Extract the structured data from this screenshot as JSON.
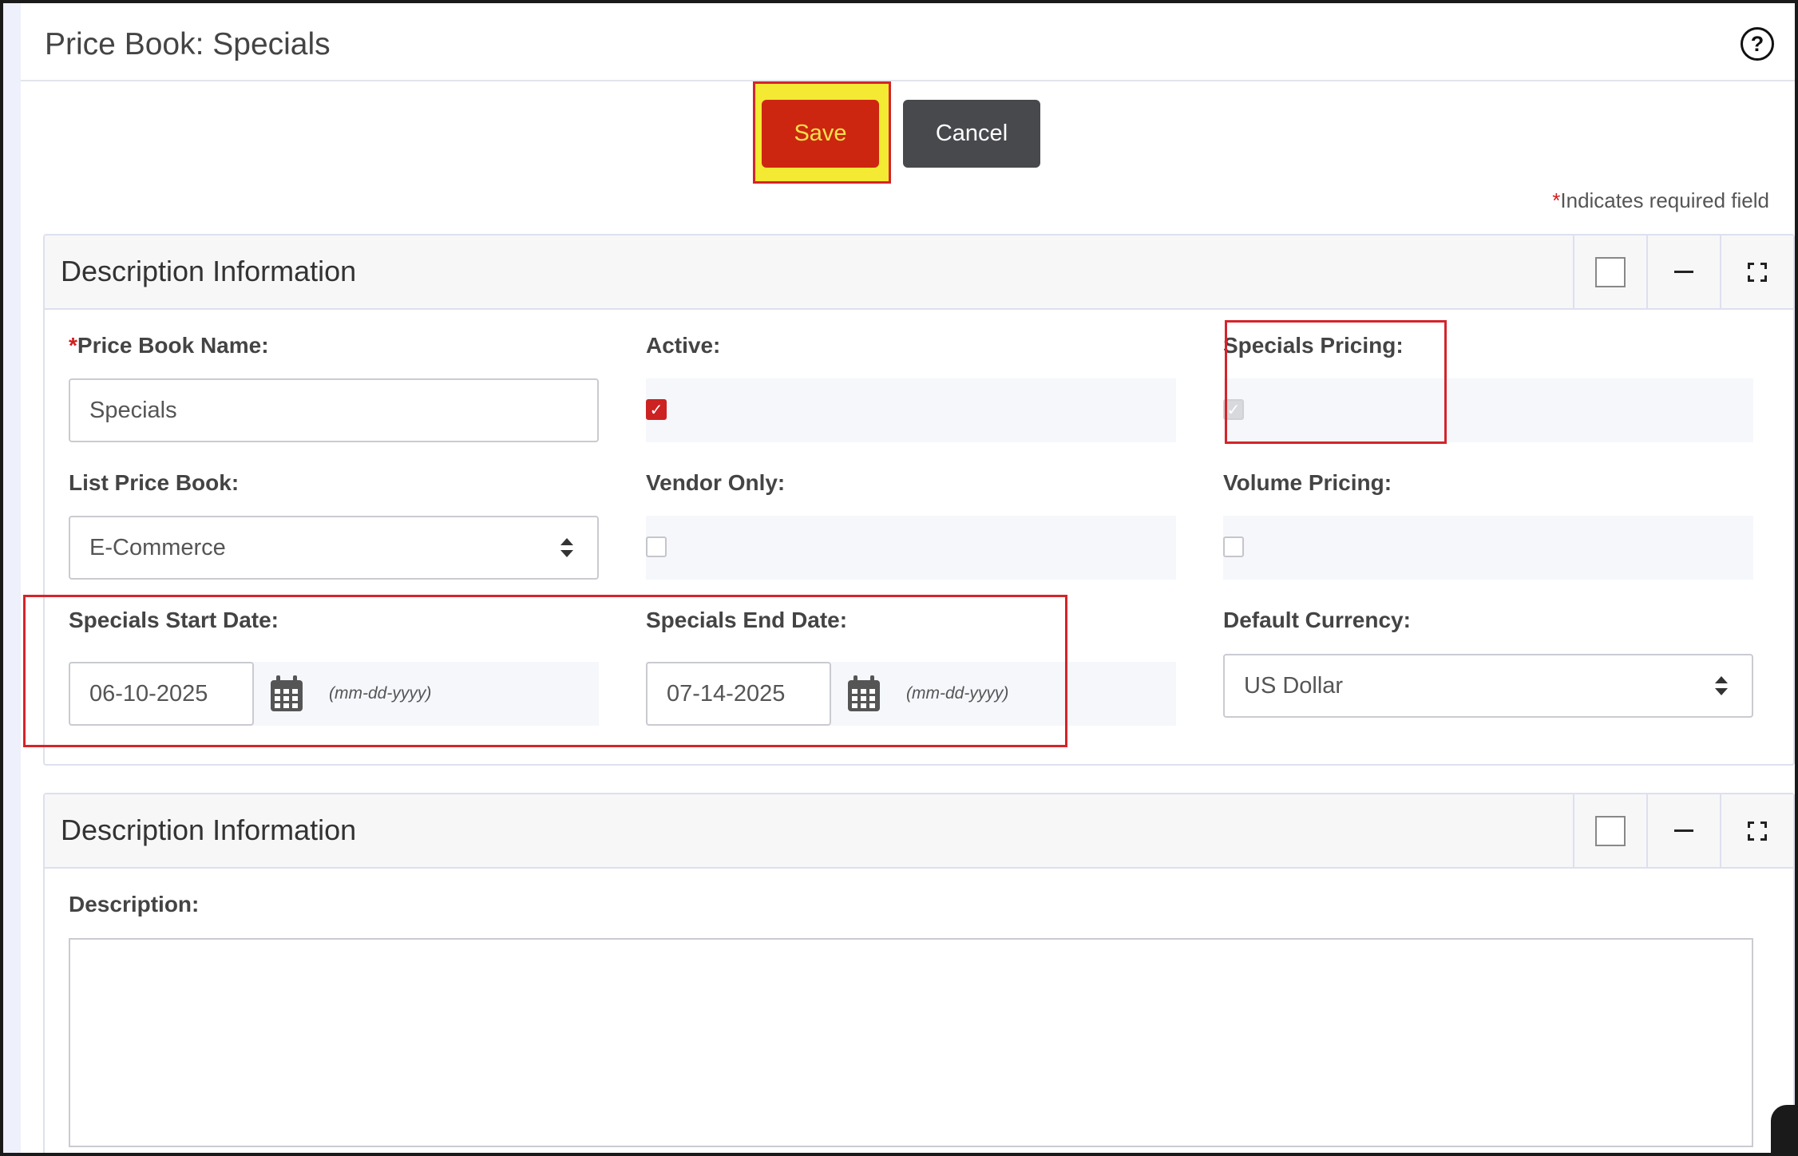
{
  "page": {
    "title": "Price Book: Specials",
    "help_icon": "?"
  },
  "toolbar": {
    "save_label": "Save",
    "cancel_label": "Cancel"
  },
  "required_note": {
    "star": "*",
    "text": "Indicates required field"
  },
  "panel1": {
    "title": "Description Information",
    "fields": {
      "price_book_name": {
        "label": "Price Book Name:",
        "required_star": "*",
        "value": "Specials"
      },
      "active": {
        "label": "Active:",
        "checked": true
      },
      "specials_pricing": {
        "label": "Specials Pricing:",
        "checked": true,
        "disabled": true
      },
      "list_price_book": {
        "label": "List Price Book:",
        "value": "E-Commerce"
      },
      "vendor_only": {
        "label": "Vendor Only:",
        "checked": false
      },
      "volume_pricing": {
        "label": "Volume Pricing:",
        "checked": false
      },
      "specials_start_date": {
        "label": "Specials Start Date:",
        "value": "06-10-2025",
        "hint": "(mm-dd-yyyy)"
      },
      "specials_end_date": {
        "label": "Specials End Date:",
        "value": "07-14-2025",
        "hint": "(mm-dd-yyyy)"
      },
      "default_currency": {
        "label": "Default Currency:",
        "value": "US Dollar"
      }
    }
  },
  "panel2": {
    "title": "Description Information",
    "fields": {
      "description": {
        "label": "Description:",
        "value": ""
      }
    }
  },
  "icons": {
    "help": "help-circle-icon",
    "calendar": "calendar-icon",
    "square": "panel-square-icon",
    "minimize": "minimize-icon",
    "fullscreen": "fullscreen-icon"
  },
  "colors": {
    "save_button_bg": "#cc2610",
    "save_button_text": "#f5e04a",
    "save_highlight_bg": "#f4ea33",
    "cancel_button_bg": "#48494d",
    "highlight_border": "#d4242a",
    "required_star": "#d21e1e"
  }
}
